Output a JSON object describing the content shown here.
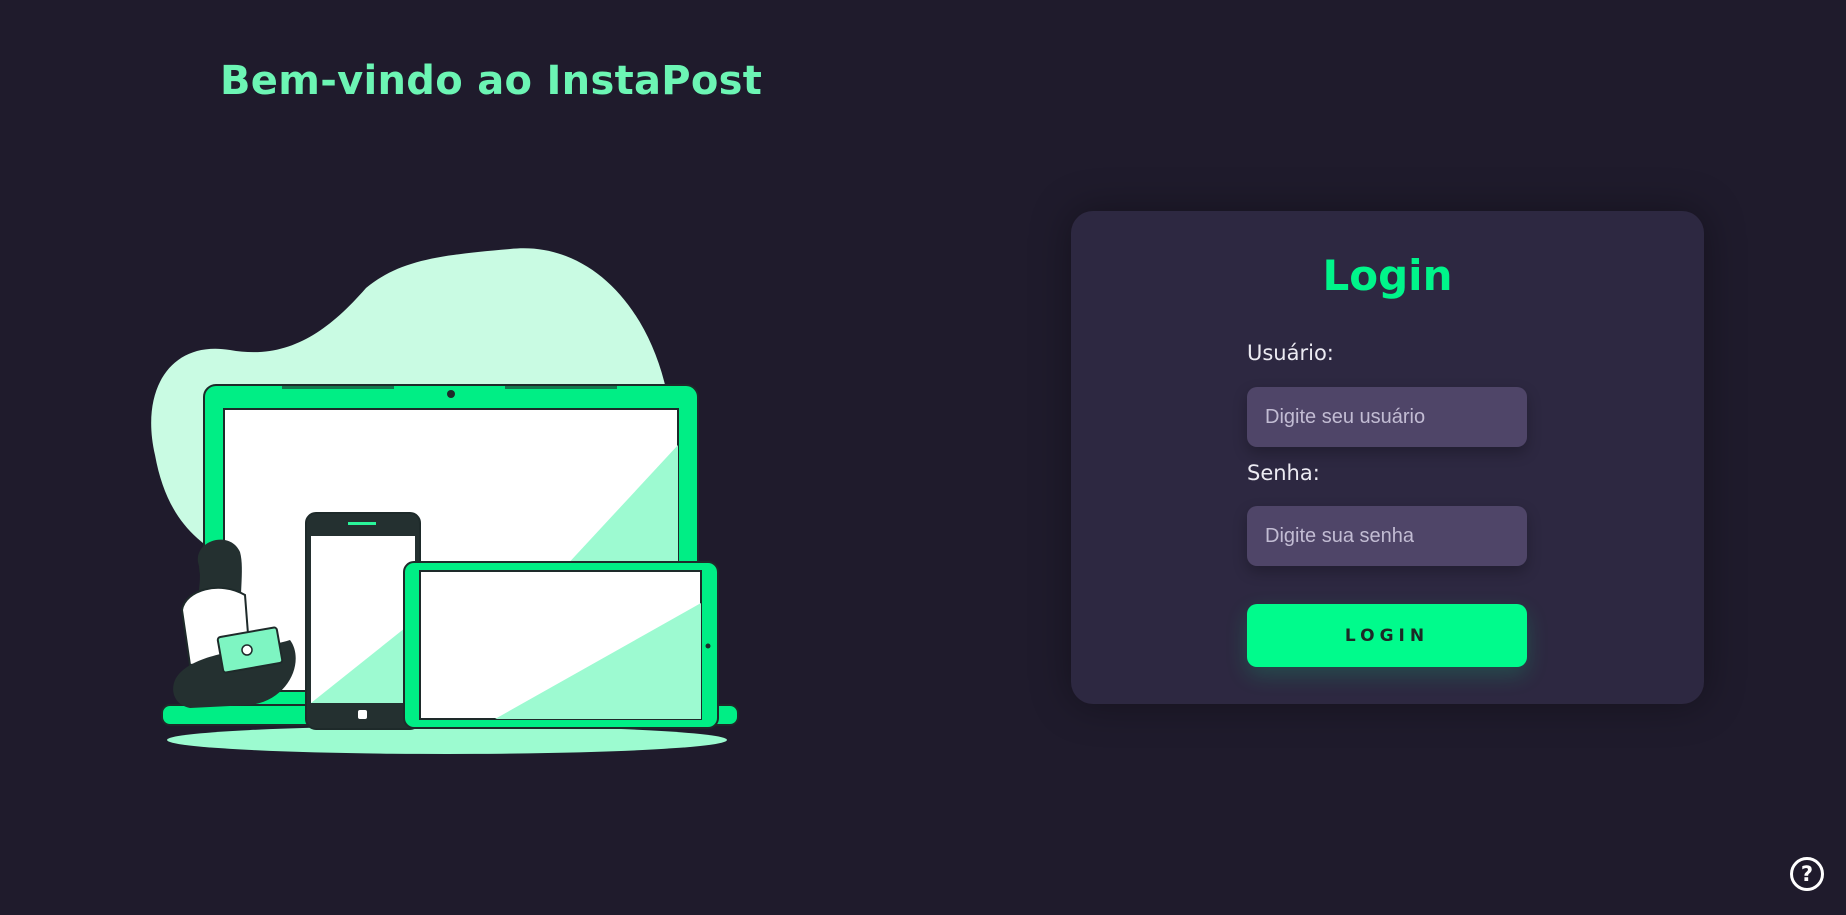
{
  "header": {
    "title": "Bem-vindo ao InstaPost"
  },
  "illustration": {
    "icon": "devices-illustration"
  },
  "login": {
    "heading": "Login",
    "username_label": "Usuário:",
    "username_placeholder": "Digite seu usuário",
    "username_value": "",
    "password_label": "Senha:",
    "password_placeholder": "Digite sua senha",
    "password_value": "",
    "button_label": "LOGIN"
  },
  "help": {
    "symbol": "?",
    "icon": "help-icon"
  },
  "colors": {
    "background": "#1f1b2c",
    "card": "#2d2841",
    "accent": "#00fb8c",
    "title": "#6cf5b4",
    "input": "#4f4568"
  }
}
